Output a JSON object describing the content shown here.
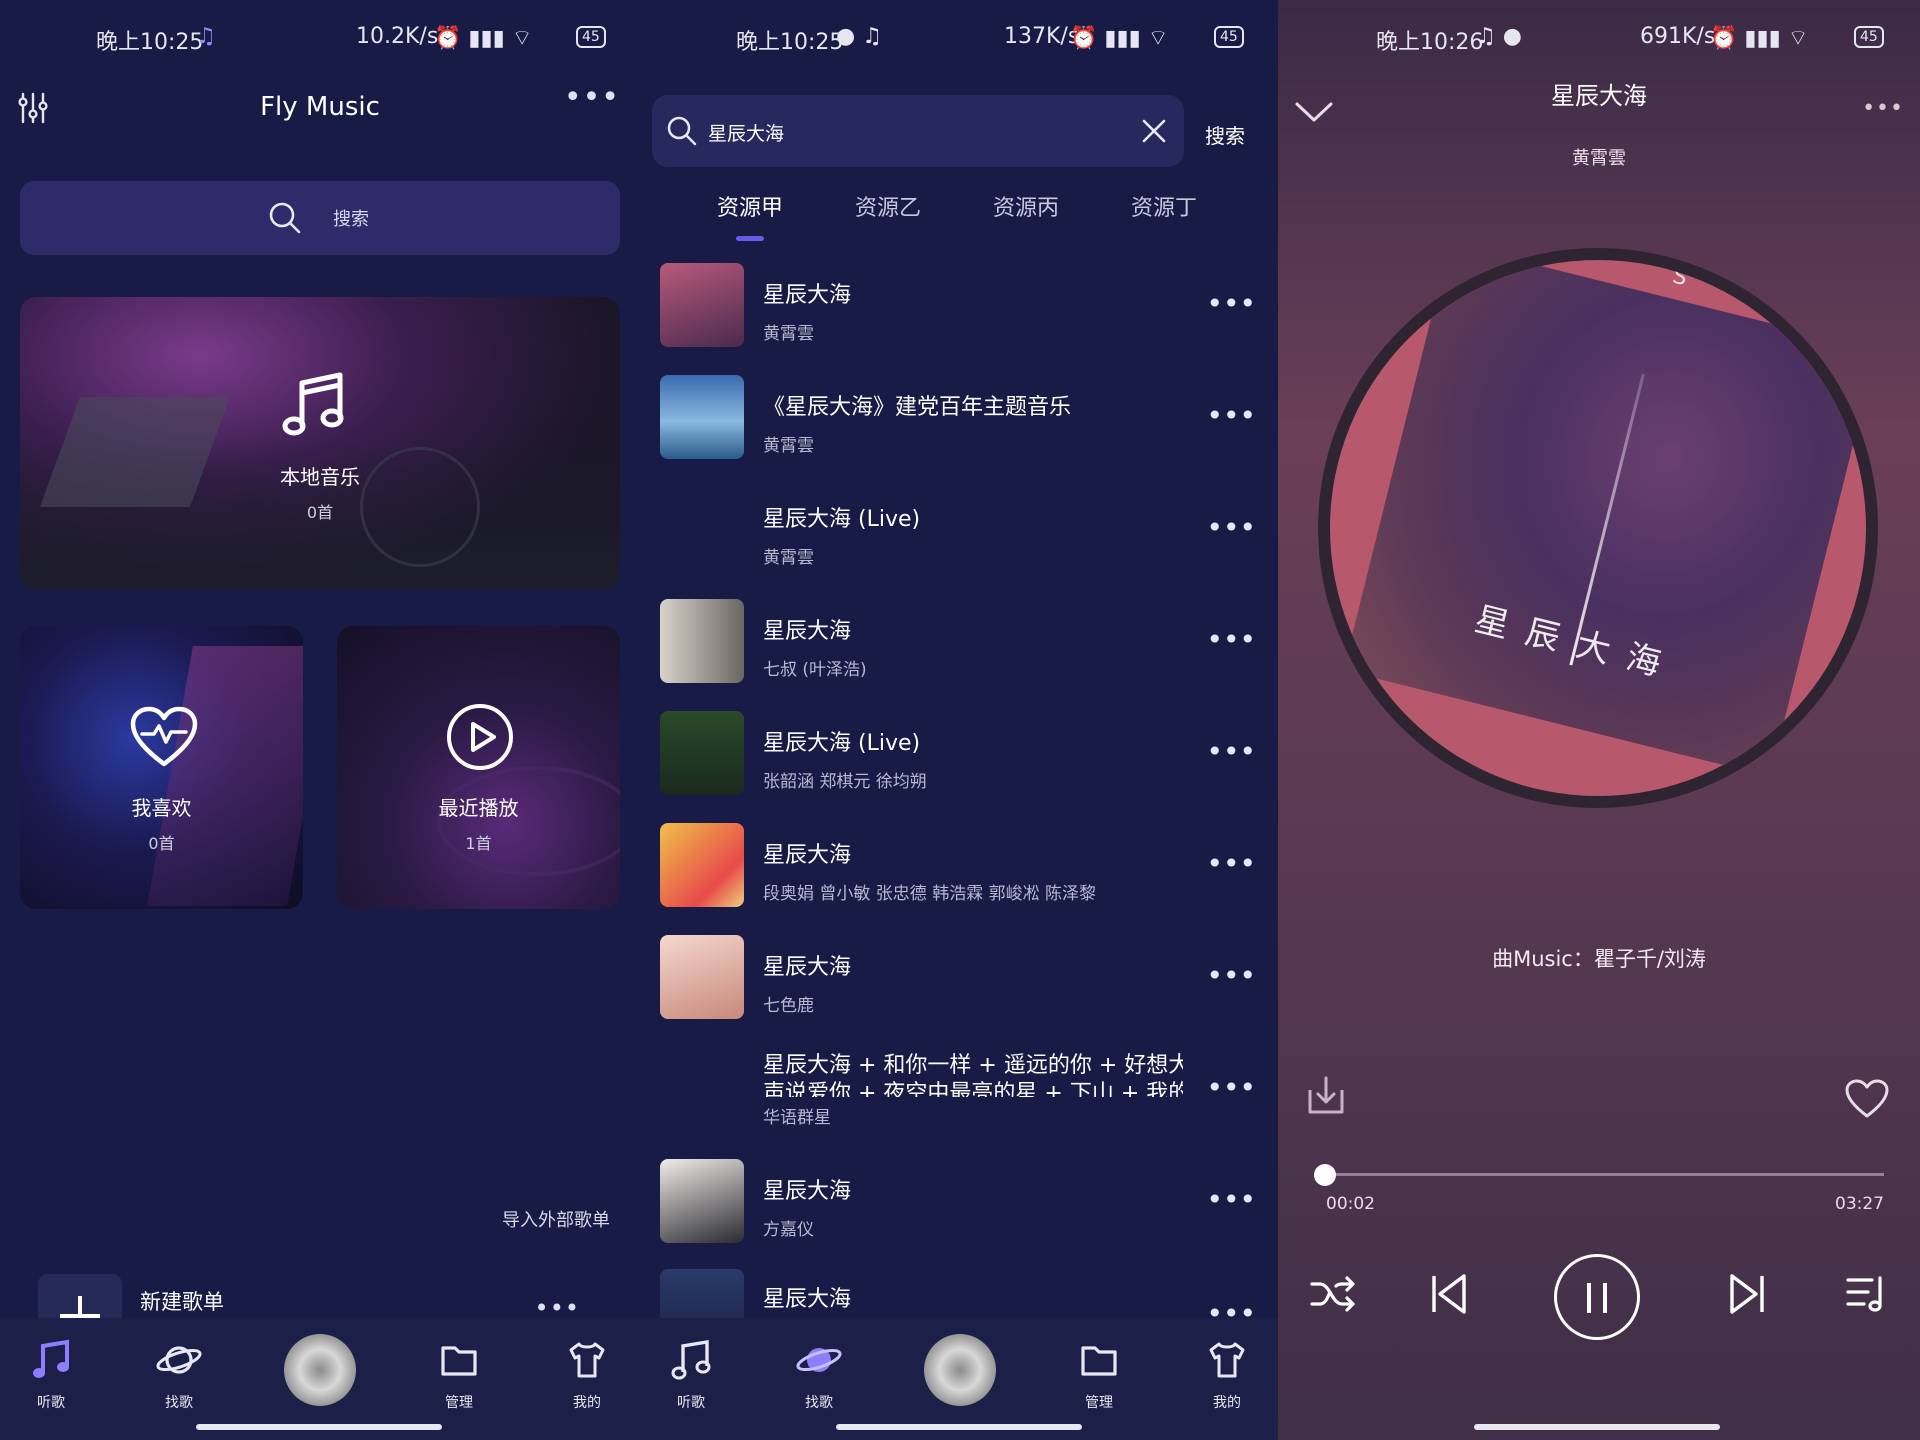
{
  "panel_home": {
    "status": {
      "time": "晚上10:25",
      "speed": "10.2K/s",
      "battery": "45"
    },
    "app_title": "Fly Music",
    "search_label": "搜索",
    "cards": [
      {
        "title": "本地音乐",
        "count": "0首"
      },
      {
        "title": "我喜欢",
        "count": "0首"
      },
      {
        "title": "最近播放",
        "count": "1首"
      }
    ],
    "import_label": "导入外部歌单",
    "new_playlist_label": "新建歌单",
    "nav": [
      "听歌",
      "找歌",
      "管理",
      "我的"
    ]
  },
  "panel_search": {
    "status": {
      "time": "晚上10:25",
      "speed": "137K/s",
      "battery": "45"
    },
    "query": "星辰大海",
    "search_button": "搜索",
    "tabs": [
      "资源甲",
      "资源乙",
      "资源丙",
      "资源丁"
    ],
    "results": [
      {
        "title": "星辰大海",
        "artist": "黄霄雲"
      },
      {
        "title": "《星辰大海》建党百年主题音乐",
        "artist": "黄霄雲"
      },
      {
        "title": "星辰大海 (Live)",
        "artist": "黄霄雲"
      },
      {
        "title": "星辰大海",
        "artist": "七叔 (叶泽浩)"
      },
      {
        "title": "星辰大海 (Live)",
        "artist": "张韶涵  郑棋元  徐均朔"
      },
      {
        "title": "星辰大海",
        "artist": "段奥娟  曾小敏  张忠德  韩浩霖  郭峻凇  陈泽黎"
      },
      {
        "title": "星辰大海",
        "artist": "七色鹿"
      },
      {
        "title": "星辰大海 + 和你一样 + 遥远的你 + 好想大",
        "title2": "声说爱你 + 夜空中最亮的星 + 下山 + 我的",
        "artist": "华语群星"
      },
      {
        "title": "星辰大海",
        "artist": "方嘉仪"
      },
      {
        "title": "星辰大海",
        "artist": ""
      }
    ],
    "nav": [
      "听歌",
      "找歌",
      "管理",
      "我的"
    ]
  },
  "panel_player": {
    "status": {
      "time": "晚上10:26",
      "speed": "691K/s",
      "battery": "45"
    },
    "title": "星辰大海",
    "artist": "黄霄雲",
    "album_art_text": "星辰大海",
    "album_letters": "R S &",
    "credit": "曲Music：瞿子千/刘涛",
    "elapsed": "00:02",
    "duration": "03:27",
    "progress": 0.01
  },
  "colors": {
    "bg": "#181b45",
    "accent": "#6a58e8",
    "search_bg": "#2e2b6b"
  }
}
